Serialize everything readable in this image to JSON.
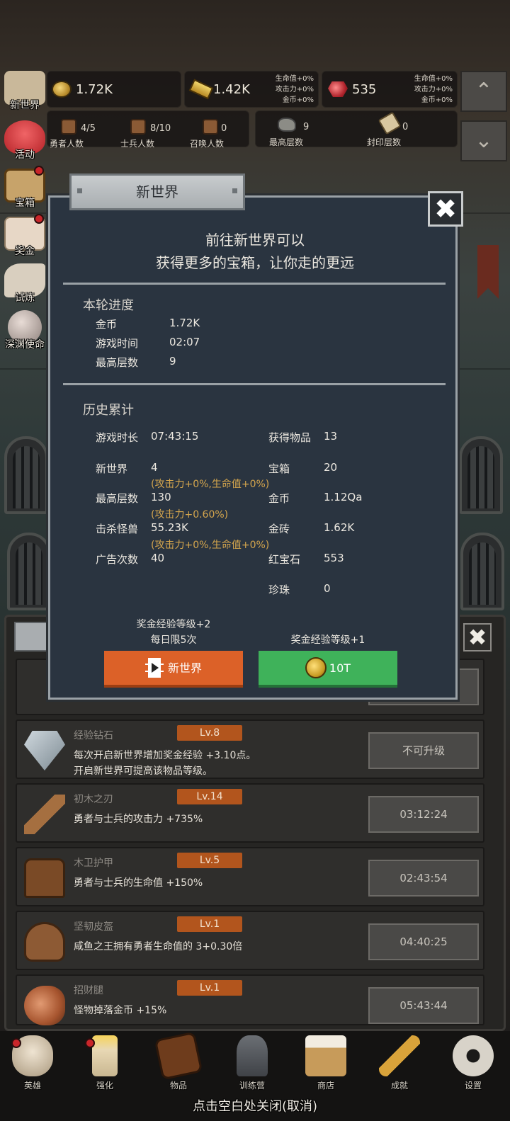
{
  "resources": {
    "coin": "1.72K",
    "gold_bar": "1.42K",
    "gold_bar_bonus": [
      "生命值+0%",
      "攻击力+0%",
      "金币+0%"
    ],
    "ruby": "535",
    "ruby_bonus": [
      "生命值+0%",
      "攻击力+0%",
      "金币+0%"
    ]
  },
  "stats": {
    "heroes": {
      "value": "4/5",
      "label": "勇者人数"
    },
    "soldiers": {
      "value": "8/10",
      "label": "士兵人数"
    },
    "summons": {
      "value": "0",
      "label": "召唤人数"
    },
    "max_floor": {
      "value": "9",
      "label": "最高层数"
    },
    "sealed_floor": {
      "value": "0",
      "label": "封印层数"
    }
  },
  "side_menu": [
    "新世界",
    "活动",
    "宝箱",
    "奖金",
    "试炼",
    "深渊使命"
  ],
  "modal": {
    "title": "新世界",
    "headline1": "前往新世界可以",
    "headline2": "获得更多的宝箱，让你走的更远",
    "round_title": "本轮进度",
    "round": [
      {
        "k": "金币",
        "v": "1.72K"
      },
      {
        "k": "游戏时间",
        "v": "02:07"
      },
      {
        "k": "最高层数",
        "v": "9"
      }
    ],
    "history_title": "历史累计",
    "history_left": [
      {
        "k": "游戏时长",
        "v": "07:43:15"
      },
      {
        "k": "新世界",
        "v": "4"
      },
      {
        "k": "最高层数",
        "v": "130"
      },
      {
        "k": "击杀怪兽",
        "v": "55.23K"
      },
      {
        "k": "广告次数",
        "v": "40"
      }
    ],
    "history_bonus": [
      "(攻击力+0%,生命值+0%)",
      "(攻击力+0.60%)",
      "(攻击力+0%,生命值+0%)"
    ],
    "history_right": [
      {
        "k": "获得物品",
        "v": "13"
      },
      {
        "k": "宝箱",
        "v": "20"
      },
      {
        "k": "金币",
        "v": "1.12Qa"
      },
      {
        "k": "金砖",
        "v": "1.62K"
      },
      {
        "k": "红宝石",
        "v": "553"
      },
      {
        "k": "珍珠",
        "v": "0"
      }
    ],
    "left_note1": "奖金经验等级+2",
    "left_note2": "每日限5次",
    "right_note": "奖金经验等级+1",
    "left_button": "新世界",
    "right_button": "10T"
  },
  "list": [
    {
      "name": "经验钻石",
      "lv": "Lv.8",
      "desc1": "每次开启新世界增加奖金经验 +3.10点。",
      "desc2": "开启新世界可提高该物品等级。",
      "btn": "不可升级",
      "icon": "diamond-icon"
    },
    {
      "name": "初木之刃",
      "lv": "Lv.14",
      "desc1": "勇者与士兵的攻击力 +735%",
      "desc2": "",
      "btn": "03:12:24",
      "icon": "wooden-sword-icon"
    },
    {
      "name": "木卫护甲",
      "lv": "Lv.5",
      "desc1": "勇者与士兵的生命值 +150%",
      "desc2": "",
      "btn": "02:43:54",
      "icon": "armor-icon"
    },
    {
      "name": "坚韧皮盔",
      "lv": "Lv.1",
      "desc1": "咸鱼之王拥有勇者生命值的 3+0.30倍",
      "desc2": "",
      "btn": "04:40:25",
      "icon": "helmet-icon"
    },
    {
      "name": "招财腿",
      "lv": "Lv.1",
      "desc1": "怪物掉落金币 +15%",
      "desc2": "",
      "btn": "05:43:44",
      "icon": "meat-leg-icon"
    }
  ],
  "nav": [
    "英雄",
    "强化",
    "物品",
    "训练营",
    "商店",
    "成就",
    "设置"
  ],
  "close_hint": "点击空白处关闭(取消)",
  "colors": {
    "accent_orange": "#dc6128",
    "accent_green": "#3fb25a",
    "bonus_text": "#d5a64d",
    "level_badge": "#b2551d"
  }
}
